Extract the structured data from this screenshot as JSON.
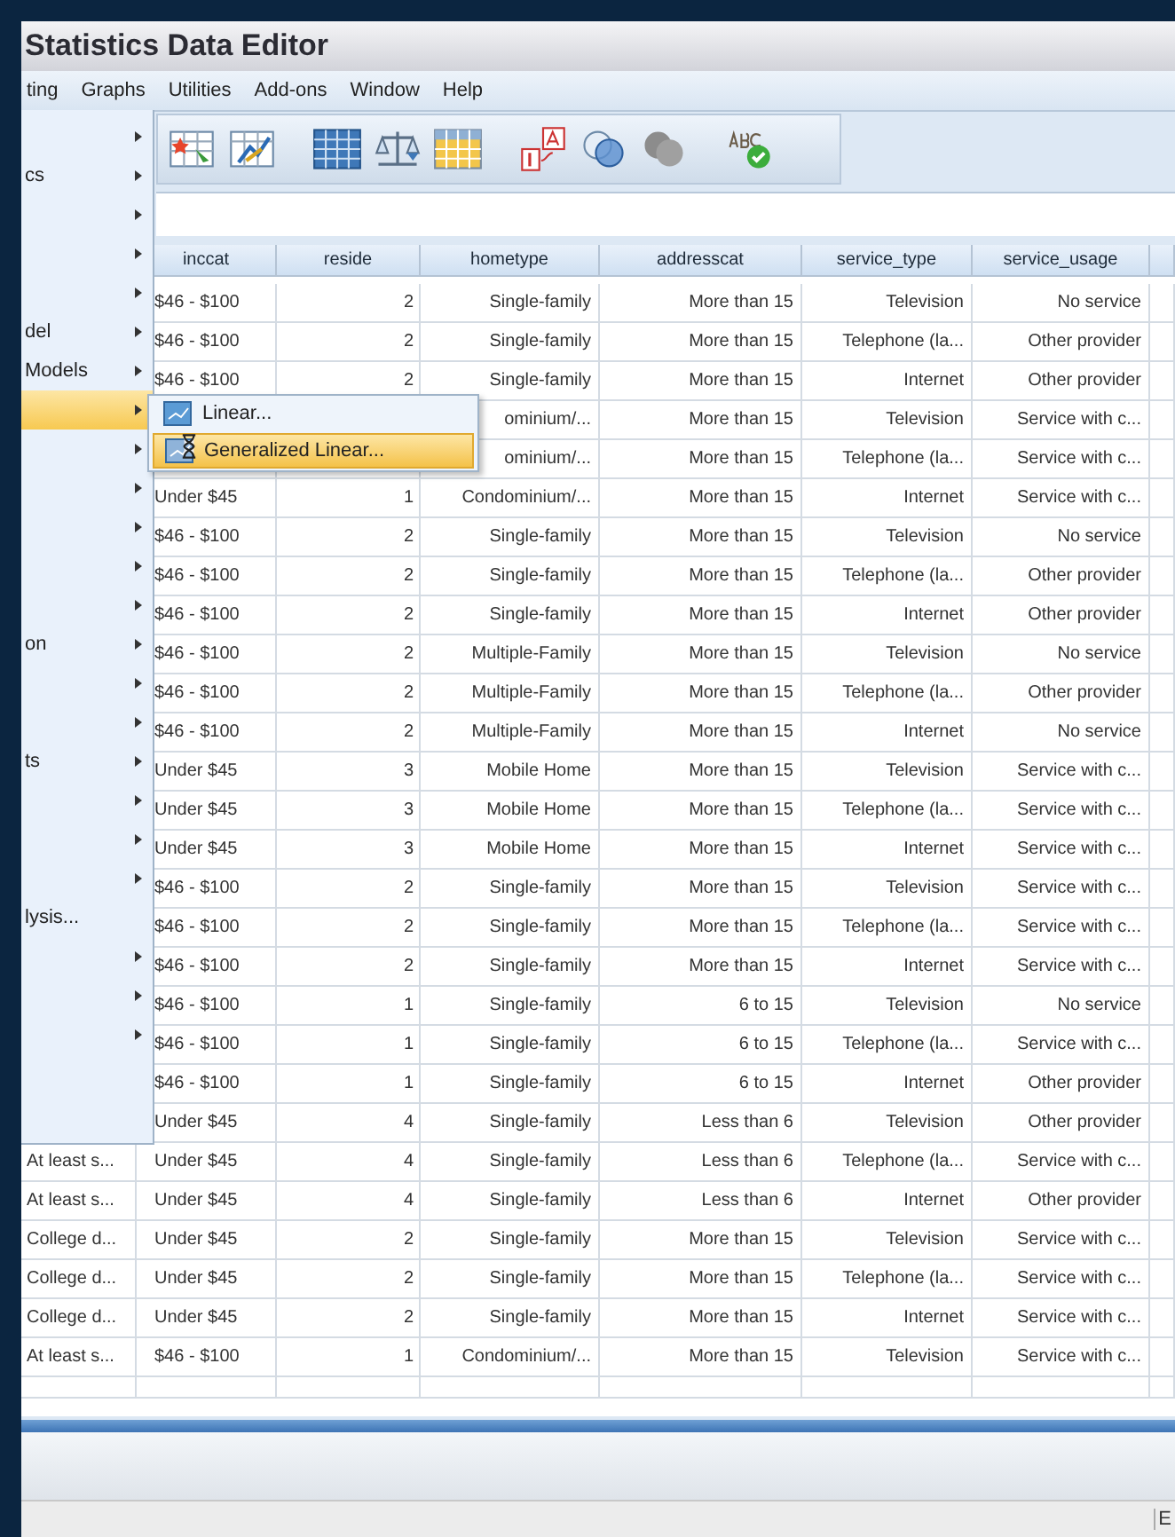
{
  "window": {
    "title": "Statistics Data Editor"
  },
  "menubar": [
    "ting",
    "Graphs",
    "Utilities",
    "Add-ons",
    "Window",
    "Help"
  ],
  "toolbar": [
    {
      "kind": "new-data"
    },
    {
      "kind": "chart-sheet"
    },
    {
      "kind": "grid"
    },
    {
      "kind": "scale"
    },
    {
      "kind": "table"
    },
    {
      "kind": "value-labels"
    },
    {
      "kind": "circles"
    },
    {
      "kind": "sets"
    },
    {
      "kind": "spell-check"
    }
  ],
  "menu": {
    "items": [
      {
        "submenu": true,
        "highlighted": false
      },
      {
        "label": "cs",
        "submenu": true,
        "highlighted": false
      },
      {
        "submenu": true,
        "highlighted": false
      },
      {
        "submenu": true,
        "highlighted": false
      },
      {
        "submenu": true,
        "highlighted": false
      },
      {
        "label": "del",
        "submenu": true,
        "highlighted": false
      },
      {
        "label": "Models",
        "submenu": true,
        "highlighted": false
      },
      {
        "submenu": true,
        "highlighted": true
      },
      {
        "submenu": true,
        "highlighted": false
      },
      {
        "submenu": true,
        "highlighted": false
      },
      {
        "submenu": true,
        "highlighted": false
      },
      {
        "submenu": true,
        "highlighted": false
      },
      {
        "submenu": true,
        "highlighted": false
      },
      {
        "label": "on",
        "submenu": true,
        "highlighted": false
      },
      {
        "submenu": true,
        "highlighted": false
      },
      {
        "submenu": true,
        "highlighted": false
      },
      {
        "label": "ts",
        "submenu": true,
        "highlighted": false
      },
      {
        "submenu": true,
        "highlighted": false
      },
      {
        "submenu": true,
        "highlighted": false
      },
      {
        "submenu": true,
        "highlighted": false
      },
      {
        "label": "lysis...",
        "submenu": false,
        "highlighted": false
      },
      {
        "submenu": true,
        "highlighted": false
      },
      {
        "submenu": true,
        "highlighted": false
      },
      {
        "submenu": true,
        "highlighted": false
      }
    ]
  },
  "submenu": {
    "items": [
      {
        "label": "Linear...",
        "selected": false
      },
      {
        "label": "Generalized Linear...",
        "selected": true
      }
    ]
  },
  "table": {
    "columns": [
      "inccat",
      "reside",
      "hometype",
      "addresscat",
      "service_type",
      "service_usage"
    ],
    "rows": [
      {
        "cells": [
          "$46 - $100",
          "2",
          "Single-family",
          "More than 15",
          "Television",
          "No service"
        ]
      },
      {
        "cells": [
          "$46 - $100",
          "2",
          "Single-family",
          "More than 15",
          "Telephone (la...",
          "Other provider"
        ]
      },
      {
        "cells": [
          "$46 - $100",
          "2",
          "Single-family",
          "More than 15",
          "Internet",
          "Other provider"
        ]
      },
      {
        "cells": [
          null,
          null,
          "ominium/...",
          "More than 15",
          "Television",
          "Service with c..."
        ]
      },
      {
        "cells": [
          null,
          null,
          "ominium/...",
          "More than 15",
          "Telephone (la...",
          "Service with c..."
        ]
      },
      {
        "cells": [
          "Under $45",
          "1",
          "Condominium/...",
          "More than 15",
          "Internet",
          "Service with c..."
        ]
      },
      {
        "cells": [
          "$46 - $100",
          "2",
          "Single-family",
          "More than 15",
          "Television",
          "No service"
        ]
      },
      {
        "cells": [
          "$46 - $100",
          "2",
          "Single-family",
          "More than 15",
          "Telephone (la...",
          "Other provider"
        ]
      },
      {
        "cells": [
          "$46 - $100",
          "2",
          "Single-family",
          "More than 15",
          "Internet",
          "Other provider"
        ]
      },
      {
        "cells": [
          "$46 - $100",
          "2",
          "Multiple-Family",
          "More than 15",
          "Television",
          "No service"
        ]
      },
      {
        "cells": [
          "$46 - $100",
          "2",
          "Multiple-Family",
          "More than 15",
          "Telephone (la...",
          "Other provider"
        ]
      },
      {
        "cells": [
          "$46 - $100",
          "2",
          "Multiple-Family",
          "More than 15",
          "Internet",
          "No service"
        ]
      },
      {
        "cells": [
          "Under $45",
          "3",
          "Mobile Home",
          "More than 15",
          "Television",
          "Service with c..."
        ]
      },
      {
        "cells": [
          "Under $45",
          "3",
          "Mobile Home",
          "More than 15",
          "Telephone (la...",
          "Service with c..."
        ]
      },
      {
        "cells": [
          "Under $45",
          "3",
          "Mobile Home",
          "More than 15",
          "Internet",
          "Service with c..."
        ]
      },
      {
        "cells": [
          "$46 - $100",
          "2",
          "Single-family",
          "More than 15",
          "Television",
          "Service with c..."
        ]
      },
      {
        "cells": [
          "$46 - $100",
          "2",
          "Single-family",
          "More than 15",
          "Telephone (la...",
          "Service with c..."
        ]
      },
      {
        "cells": [
          "$46 - $100",
          "2",
          "Single-family",
          "More than 15",
          "Internet",
          "Service with c..."
        ]
      },
      {
        "cells": [
          "$46 - $100",
          "1",
          "Single-family",
          "6 to 15",
          "Television",
          "No service"
        ]
      },
      {
        "cells": [
          "$46 - $100",
          "1",
          "Single-family",
          "6 to 15",
          "Telephone (la...",
          "Service with c..."
        ]
      },
      {
        "cells": [
          "$46 - $100",
          "1",
          "Single-family",
          "6 to 15",
          "Internet",
          "Other provider"
        ]
      },
      {
        "cells": [
          "Under $45",
          "4",
          "Single-family",
          "Less than 6",
          "Television",
          "Other provider"
        ]
      },
      {
        "column_1": "At least s...",
        "cells": [
          "Under $45",
          "4",
          "Single-family",
          "Less than 6",
          "Telephone (la...",
          "Service with c..."
        ]
      },
      {
        "column_1": "At least s...",
        "cells": [
          "Under $45",
          "4",
          "Single-family",
          "Less than 6",
          "Internet",
          "Other provider"
        ]
      },
      {
        "column_1": "College d...",
        "cells": [
          "Under $45",
          "2",
          "Single-family",
          "More than 15",
          "Television",
          "Service with c..."
        ]
      },
      {
        "column_1": "College d...",
        "cells": [
          "Under $45",
          "2",
          "Single-family",
          "More than 15",
          "Telephone (la...",
          "Service with c..."
        ]
      },
      {
        "column_1": "College d...",
        "cells": [
          "Under $45",
          "2",
          "Single-family",
          "More than 15",
          "Internet",
          "Service with c..."
        ]
      },
      {
        "column_1": "At least s...",
        "cells": [
          "$46 - $100",
          "1",
          "Condominium/...",
          "More than 15",
          "Television",
          "Service with c..."
        ]
      }
    ]
  },
  "status_bar": {
    "text": "E"
  }
}
